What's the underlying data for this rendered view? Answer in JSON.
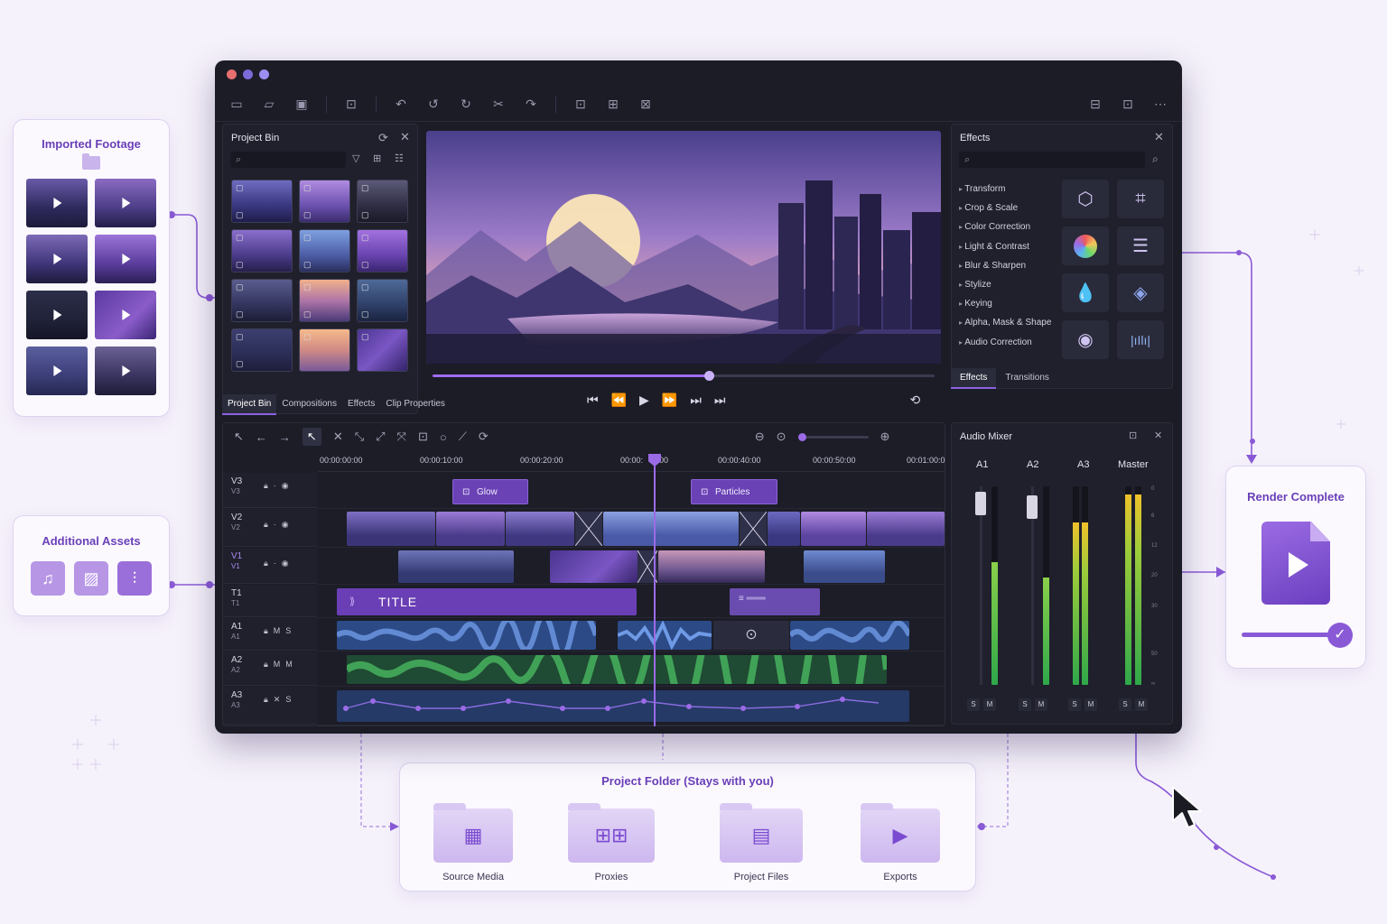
{
  "imported": {
    "title": "Imported Footage"
  },
  "additional": {
    "title": "Additional Assets",
    "assets": [
      "music-note-icon",
      "image-icon",
      "waveform-icon"
    ]
  },
  "render": {
    "title": "Render Complete",
    "progress": 1.0
  },
  "project_folder": {
    "title": "Project Folder (Stays with you)",
    "folders": [
      {
        "label": "Source Media",
        "icon": "film-icon"
      },
      {
        "label": "Proxies",
        "icon": "grid-icon"
      },
      {
        "label": "Project Files",
        "icon": "document-icon"
      },
      {
        "label": "Exports",
        "icon": "play-icon"
      }
    ]
  },
  "project_bin": {
    "title": "Project Bin",
    "tabs": [
      "Project Bin",
      "Compositions",
      "Effects",
      "Clip Properties"
    ]
  },
  "effects_panel": {
    "title": "Effects",
    "items": [
      "Transform",
      "Crop & Scale",
      "Color Correction",
      "Light & Contrast",
      "Blur & Sharpen",
      "Stylize",
      "Keying",
      "Alpha, Mask & Shape",
      "Audio Correction"
    ],
    "tabs": [
      "Effects",
      "Transitions"
    ]
  },
  "viewer": {
    "progress": 0.55
  },
  "timeline": {
    "ruler": [
      "00:00:00:00",
      "00:00:10:00",
      "00:00:20:00",
      "00:00:",
      "00",
      "00:00:40:00",
      "00:00:50:00",
      "00:01:00:0"
    ],
    "tracks": [
      {
        "name": "V3",
        "sub": "V3"
      },
      {
        "name": "V2",
        "sub": "V2"
      },
      {
        "name": "V1",
        "sub": "V1"
      },
      {
        "name": "T1",
        "sub": "T1"
      },
      {
        "name": "A1",
        "sub": "A1"
      },
      {
        "name": "A2",
        "sub": "A2"
      },
      {
        "name": "A3",
        "sub": "A3"
      }
    ],
    "fx_clips": [
      "Glow",
      "Particles"
    ],
    "title_clip": "TITLE"
  },
  "mixer": {
    "title": "Audio Mixer",
    "channels": [
      "A1",
      "A2",
      "A3",
      "Master"
    ],
    "scale": [
      "0",
      "6",
      "12",
      "20",
      "30",
      "50",
      "∞"
    ],
    "solo": "S",
    "mute": "M"
  },
  "colors": {
    "accent": "#8c60e0",
    "brand": "#6a3fb8",
    "window_bg": "#1b1c26"
  }
}
